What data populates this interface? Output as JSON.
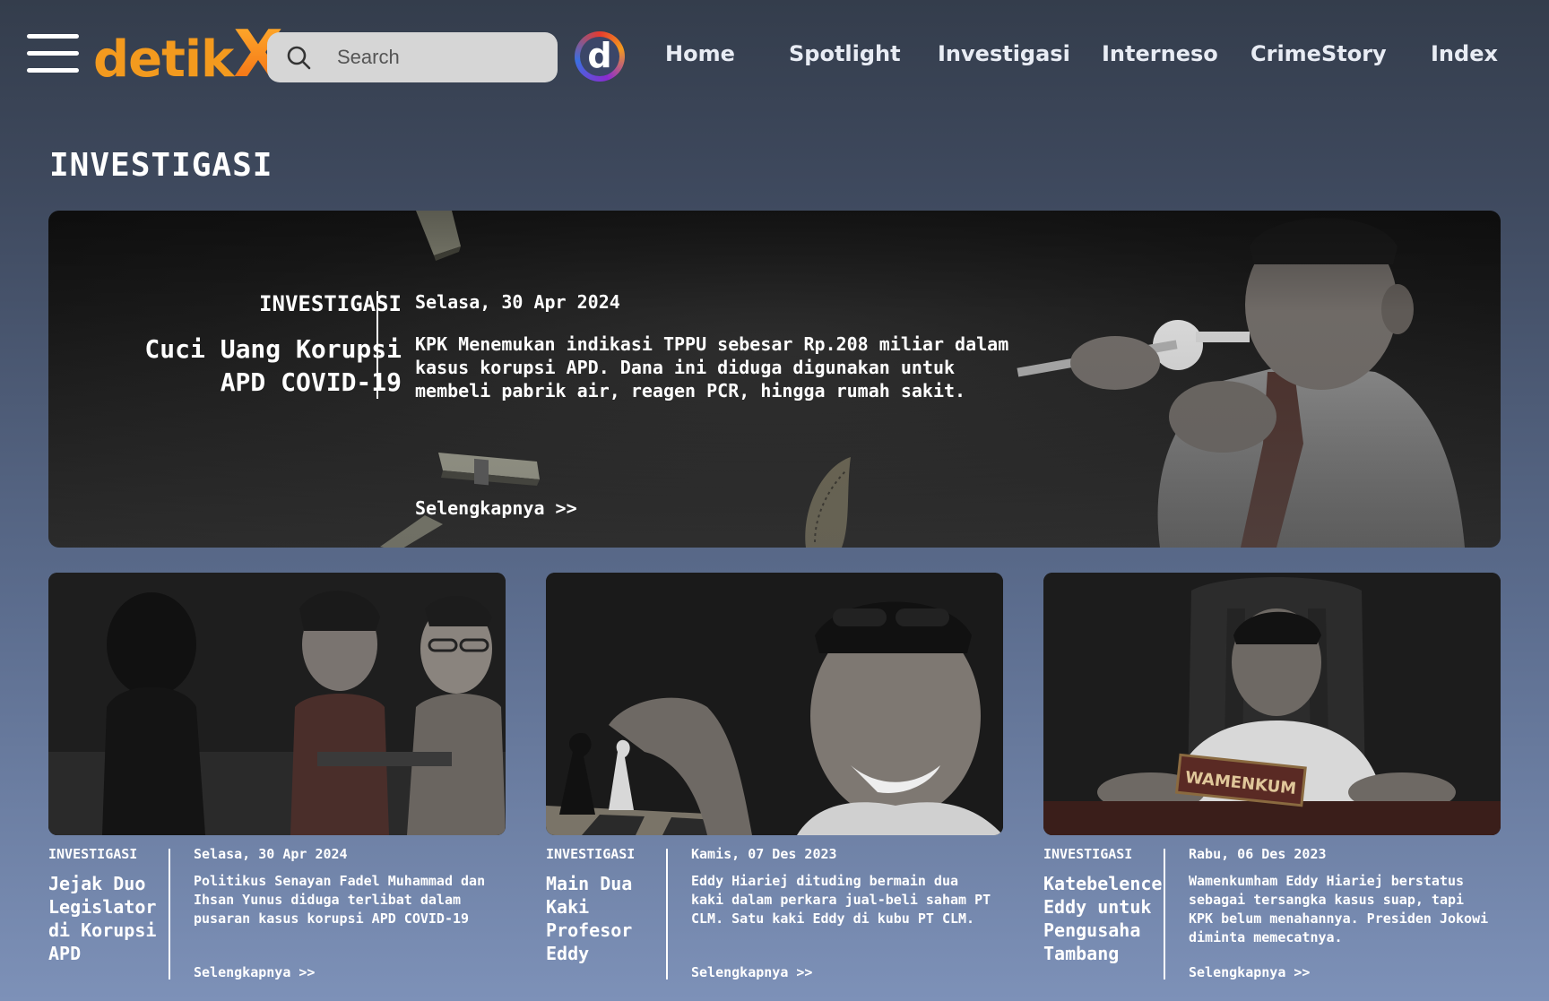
{
  "header": {
    "logo_text": "detik",
    "logo_x": "X",
    "search_placeholder": "Search",
    "d_logo": "d",
    "nav": [
      "Home",
      "Spotlight",
      "Investigasi",
      "Interneso",
      "CrimeStory",
      "Index"
    ]
  },
  "section_title": "INVESTIGASI",
  "hero": {
    "category": "INVESTIGASI",
    "title": "Cuci Uang Korupsi APD COVID-19",
    "date": "Selasa, 30 Apr 2024",
    "description": "KPK Menemukan indikasi TPPU sebesar Rp.208 miliar dalam kasus korupsi APD. Dana ini diduga digunakan untuk membeli pabrik air, reagen PCR, hingga rumah sakit.",
    "more": "Selengkapnya >>"
  },
  "cards": [
    {
      "category": "INVESTIGASI",
      "title": "Jejak Duo Legislator di Korupsi APD",
      "date": "Selasa, 30 Apr 2024",
      "description": "Politikus Senayan Fadel Muhammad dan Ihsan Yunus diduga terlibat dalam pusaran kasus korupsi APD COVID-19",
      "more": "Selengkapnya >>"
    },
    {
      "category": "INVESTIGASI",
      "title": "Main Dua Kaki Profesor Eddy",
      "date": "Kamis, 07 Des 2023",
      "description": "Eddy Hiariej dituding bermain dua kaki dalam perkara jual-beli saham PT CLM. Satu kaki Eddy di kubu PT CLM.",
      "more": "Selengkapnya >>"
    },
    {
      "category": "INVESTIGASI",
      "title": "Katebelence Eddy untuk Pengusaha Tambang",
      "date": "Rabu, 06 Des 2023",
      "description": "Wamenkumham Eddy Hiariej berstatus sebagai tersangka kasus suap, tapi KPK belum menahannya. Presiden Jokowi diminta memecatnya.",
      "more": "Selengkapnya >>",
      "image_sign_text": "WAMENKUM"
    }
  ]
}
